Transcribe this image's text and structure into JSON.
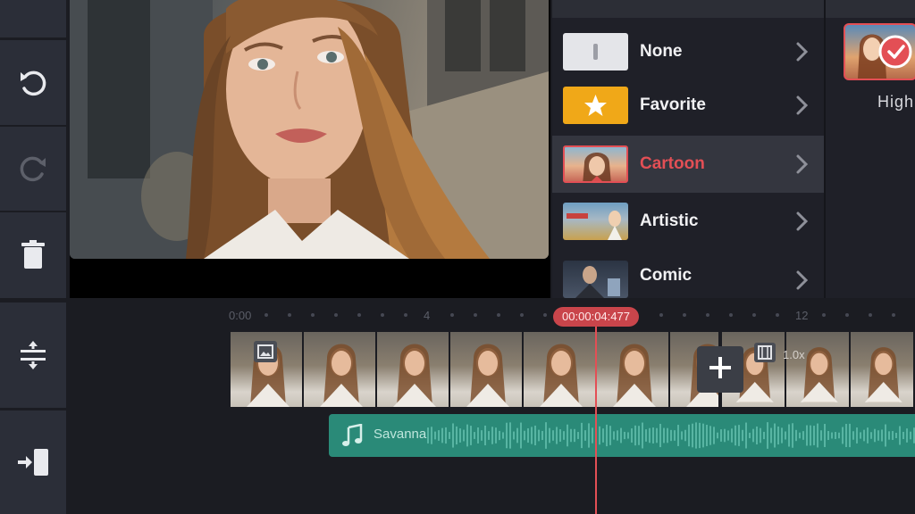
{
  "toolbar": {
    "items": [
      {
        "icon": "undo-icon"
      },
      {
        "icon": "redo-icon"
      },
      {
        "icon": "trash-icon"
      },
      {
        "icon": "split-icon"
      },
      {
        "icon": "import-icon"
      }
    ]
  },
  "effect_panel": {
    "categories": [
      {
        "label": "None",
        "icon": "none-swatch"
      },
      {
        "label": "Favorite",
        "icon": "star-icon"
      },
      {
        "label": "Cartoon",
        "icon": "cartoon-thumbnail",
        "active": true
      },
      {
        "label": "Artistic",
        "icon": "artistic-thumbnail"
      },
      {
        "label": "Comic",
        "icon": "comic-thumbnail"
      }
    ],
    "selected_style": {
      "label": "High",
      "icon": "check-icon"
    }
  },
  "timeline": {
    "ruler": [
      "0:00",
      "4",
      "12"
    ],
    "playhead_time": "00:00:04:477",
    "speed": "1.0x",
    "audio_track": {
      "label": "Savanna",
      "icon": "music-note-icon"
    }
  },
  "colors": {
    "accent": "#e34f55",
    "audio": "#2a8a78",
    "panel": "#1f2028",
    "toolbar_button": "#2b2e38"
  }
}
